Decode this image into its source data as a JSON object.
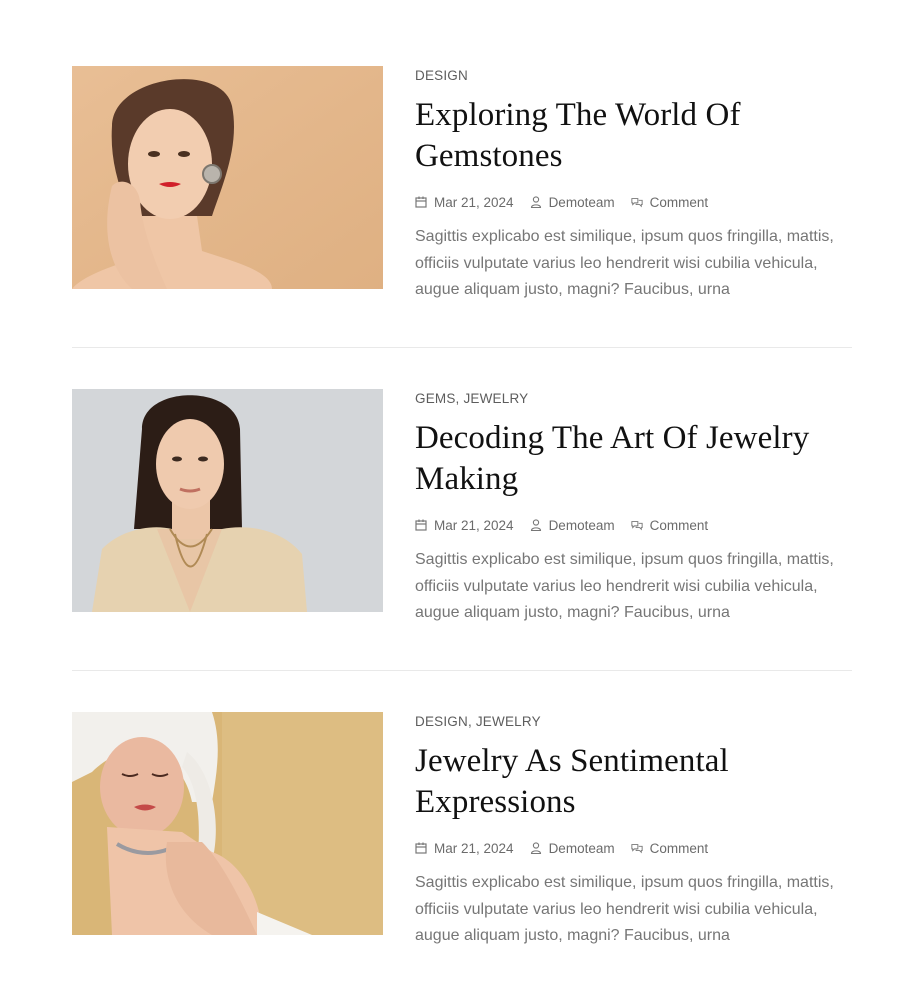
{
  "posts": [
    {
      "category": "DESIGN",
      "title": "Exploring The World Of Gemstones",
      "date": "Mar 21, 2024",
      "author": "Demoteam",
      "comment": "Comment",
      "excerpt": "Sagittis explicabo est similique, ipsum quos fringilla, mattis, officiis vulputate varius leo hendrerit wisi cubilia vehicula, augue aliquam justo, magni? Faucibus, urna",
      "image_bg": "#e5b98e"
    },
    {
      "category": "GEMS, JEWELRY",
      "title": "Decoding The Art Of Jewelry Making",
      "date": "Mar 21, 2024",
      "author": "Demoteam",
      "comment": "Comment",
      "excerpt": "Sagittis explicabo est similique, ipsum quos fringilla, mattis, officiis vulputate varius leo hendrerit wisi cubilia vehicula, augue aliquam justo, magni? Faucibus, urna",
      "image_bg": "#d3d6d9"
    },
    {
      "category": "DESIGN, JEWELRY",
      "title": "Jewelry As Sentimental Expressions",
      "date": "Mar 21, 2024",
      "author": "Demoteam",
      "comment": "Comment",
      "excerpt": "Sagittis explicabo est similique, ipsum quos fringilla, mattis, officiis vulputate varius leo hendrerit wisi cubilia vehicula, augue aliquam justo, magni? Faucibus, urna",
      "image_bg": "#d9b677"
    }
  ],
  "icons": {
    "date": "calendar-icon",
    "author": "user-icon",
    "comment": "comment-icon"
  },
  "colors": {
    "text": "#111111",
    "muted": "#767676",
    "divider": "#e9e9e9"
  }
}
